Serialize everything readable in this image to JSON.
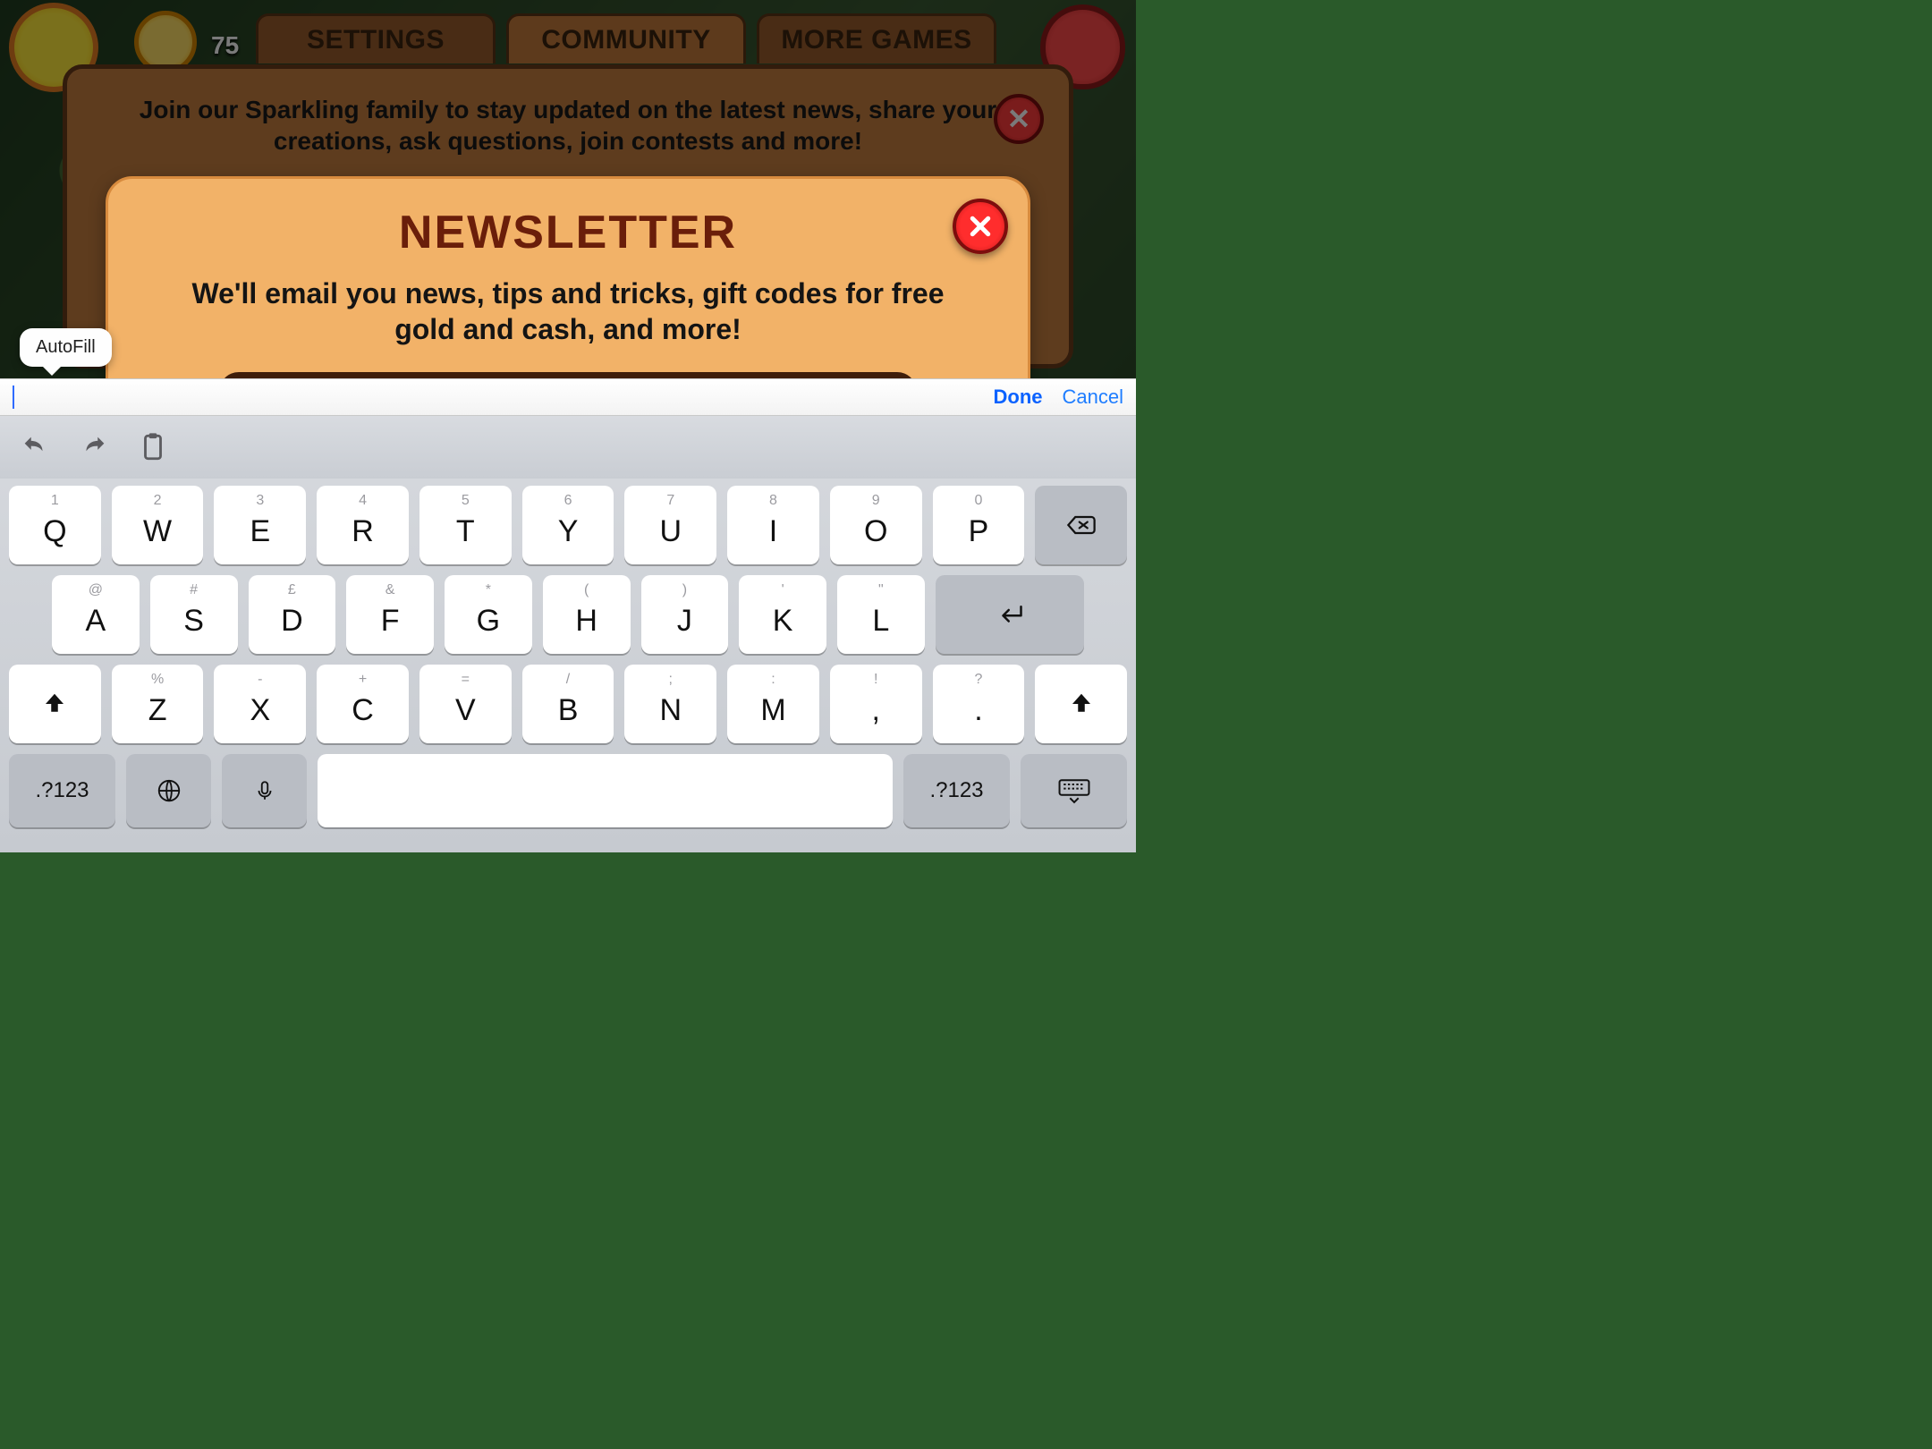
{
  "hud": {
    "coins": "75"
  },
  "tabs": {
    "settings": "SETTINGS",
    "community": "COMMUNITY",
    "more_games": "MORE GAMES"
  },
  "community": {
    "subtitle": "Join our Sparkling family to stay updated on the latest news, share your creations, ask questions, join contests and more!"
  },
  "newsletter": {
    "title": "NEWSLETTER",
    "body": "We'll email you news, tips and tricks, gift codes for free gold and cash, and more!"
  },
  "autofill_label": "AutoFill",
  "input_bar": {
    "value": "",
    "done": "Done",
    "cancel": "Cancel"
  },
  "keyboard": {
    "row1": [
      {
        "sub": "1",
        "main": "Q"
      },
      {
        "sub": "2",
        "main": "W"
      },
      {
        "sub": "3",
        "main": "E"
      },
      {
        "sub": "4",
        "main": "R"
      },
      {
        "sub": "5",
        "main": "T"
      },
      {
        "sub": "6",
        "main": "Y"
      },
      {
        "sub": "7",
        "main": "U"
      },
      {
        "sub": "8",
        "main": "I"
      },
      {
        "sub": "9",
        "main": "O"
      },
      {
        "sub": "0",
        "main": "P"
      }
    ],
    "row2": [
      {
        "sub": "@",
        "main": "A"
      },
      {
        "sub": "#",
        "main": "S"
      },
      {
        "sub": "£",
        "main": "D"
      },
      {
        "sub": "&",
        "main": "F"
      },
      {
        "sub": "*",
        "main": "G"
      },
      {
        "sub": "(",
        "main": "H"
      },
      {
        "sub": ")",
        "main": "J"
      },
      {
        "sub": "'",
        "main": "K"
      },
      {
        "sub": "\"",
        "main": "L"
      }
    ],
    "row3": [
      {
        "sub": "%",
        "main": "Z"
      },
      {
        "sub": "-",
        "main": "X"
      },
      {
        "sub": "+",
        "main": "C"
      },
      {
        "sub": "=",
        "main": "V"
      },
      {
        "sub": "/",
        "main": "B"
      },
      {
        "sub": ";",
        "main": "N"
      },
      {
        "sub": ":",
        "main": "M"
      },
      {
        "sub": "!",
        "main": ","
      },
      {
        "sub": "?",
        "main": "."
      }
    ],
    "numswitch": ".?123"
  }
}
